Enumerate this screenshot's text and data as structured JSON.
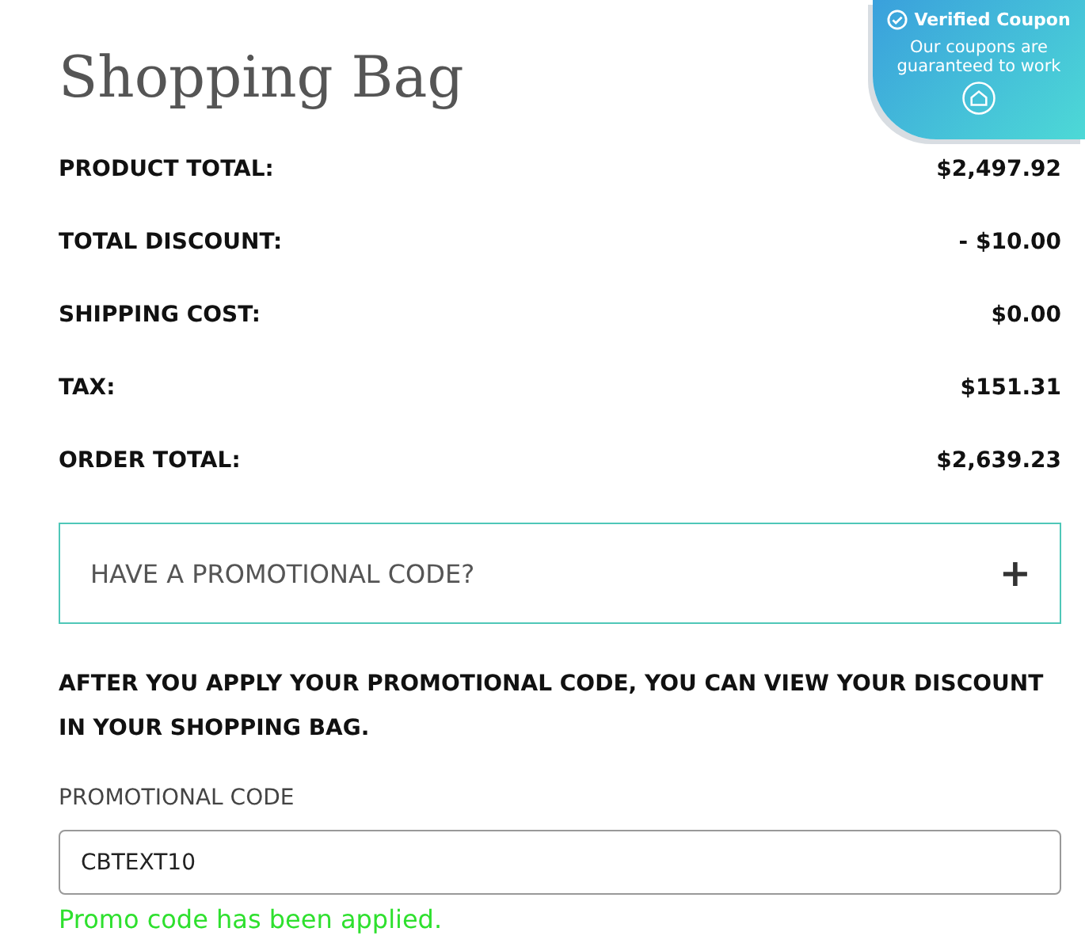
{
  "title": "Shopping Bag",
  "summary": [
    {
      "label": "PRODUCT TOTAL:",
      "value": "$2,497.92"
    },
    {
      "label": "TOTAL DISCOUNT:",
      "value": "- $10.00"
    },
    {
      "label": "SHIPPING COST:",
      "value": "$0.00"
    },
    {
      "label": "TAX:",
      "value": "$151.31"
    },
    {
      "label": "ORDER TOTAL:",
      "value": "$2,639.23"
    }
  ],
  "promo_toggle": {
    "label": "HAVE A PROMOTIONAL CODE?",
    "icon": "+",
    "expanded": false
  },
  "note": "AFTER YOU APPLY YOUR PROMOTIONAL CODE, YOU CAN VIEW YOUR DISCOUNT IN YOUR SHOPPING BAG.",
  "promo_field": {
    "label": "PROMOTIONAL CODE",
    "value": "CBTEXT10"
  },
  "message": "Promo code has been applied.",
  "verified_badge": {
    "title": "Verified Coupon",
    "text": "Our coupons are guaranteed to work"
  }
}
